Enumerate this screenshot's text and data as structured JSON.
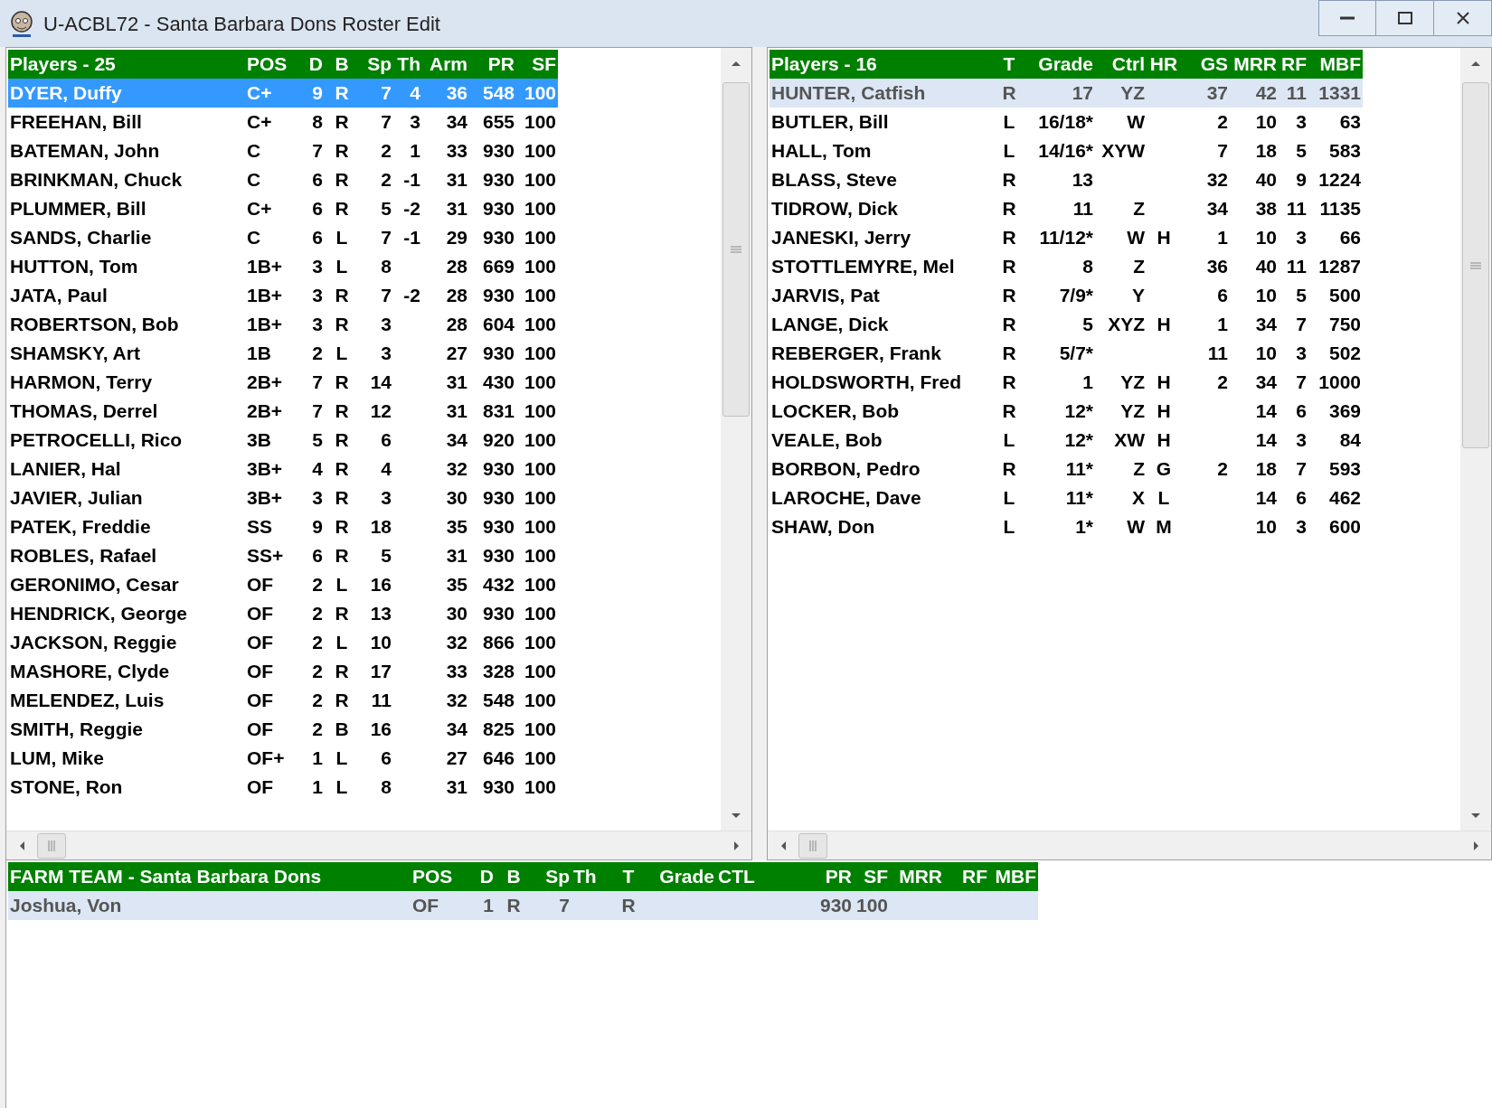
{
  "window": {
    "title": "U-ACBL72 - Santa Barbara Dons Roster Edit"
  },
  "hitters": {
    "columns": [
      "Players - 25",
      "POS",
      "D",
      "B",
      "Sp",
      "Th",
      "Arm",
      "PR",
      "SF"
    ],
    "rows": [
      {
        "selected": true,
        "cells": [
          "DYER, Duffy",
          "C+",
          "9",
          "R",
          "7",
          "4",
          "36",
          "548",
          "100"
        ]
      },
      {
        "selected": false,
        "cells": [
          "FREEHAN, Bill",
          "C+",
          "8",
          "R",
          "7",
          "3",
          "34",
          "655",
          "100"
        ]
      },
      {
        "selected": false,
        "cells": [
          "BATEMAN, John",
          "C",
          "7",
          "R",
          "2",
          "1",
          "33",
          "930",
          "100"
        ]
      },
      {
        "selected": false,
        "cells": [
          "BRINKMAN, Chuck",
          "C",
          "6",
          "R",
          "2",
          "-1",
          "31",
          "930",
          "100"
        ]
      },
      {
        "selected": false,
        "cells": [
          "PLUMMER, Bill",
          "C+",
          "6",
          "R",
          "5",
          "-2",
          "31",
          "930",
          "100"
        ]
      },
      {
        "selected": false,
        "cells": [
          "SANDS, Charlie",
          "C",
          "6",
          "L",
          "7",
          "-1",
          "29",
          "930",
          "100"
        ]
      },
      {
        "selected": false,
        "cells": [
          "HUTTON, Tom",
          "1B+",
          "3",
          "L",
          "8",
          "",
          "28",
          "669",
          "100"
        ]
      },
      {
        "selected": false,
        "cells": [
          "JATA, Paul",
          "1B+",
          "3",
          "R",
          "7",
          "-2",
          "28",
          "930",
          "100"
        ]
      },
      {
        "selected": false,
        "cells": [
          "ROBERTSON, Bob",
          "1B+",
          "3",
          "R",
          "3",
          "",
          "28",
          "604",
          "100"
        ]
      },
      {
        "selected": false,
        "cells": [
          "SHAMSKY, Art",
          "1B",
          "2",
          "L",
          "3",
          "",
          "27",
          "930",
          "100"
        ]
      },
      {
        "selected": false,
        "cells": [
          "HARMON, Terry",
          "2B+",
          "7",
          "R",
          "14",
          "",
          "31",
          "430",
          "100"
        ]
      },
      {
        "selected": false,
        "cells": [
          "THOMAS, Derrel",
          "2B+",
          "7",
          "R",
          "12",
          "",
          "31",
          "831",
          "100"
        ]
      },
      {
        "selected": false,
        "cells": [
          "PETROCELLI, Rico",
          "3B",
          "5",
          "R",
          "6",
          "",
          "34",
          "920",
          "100"
        ]
      },
      {
        "selected": false,
        "cells": [
          "LANIER, Hal",
          "3B+",
          "4",
          "R",
          "4",
          "",
          "32",
          "930",
          "100"
        ]
      },
      {
        "selected": false,
        "cells": [
          "JAVIER, Julian",
          "3B+",
          "3",
          "R",
          "3",
          "",
          "30",
          "930",
          "100"
        ]
      },
      {
        "selected": false,
        "cells": [
          "PATEK, Freddie",
          "SS",
          "9",
          "R",
          "18",
          "",
          "35",
          "930",
          "100"
        ]
      },
      {
        "selected": false,
        "cells": [
          "ROBLES, Rafael",
          "SS+",
          "6",
          "R",
          "5",
          "",
          "31",
          "930",
          "100"
        ]
      },
      {
        "selected": false,
        "cells": [
          "GERONIMO, Cesar",
          "OF",
          "2",
          "L",
          "16",
          "",
          "35",
          "432",
          "100"
        ]
      },
      {
        "selected": false,
        "cells": [
          "HENDRICK, George",
          "OF",
          "2",
          "R",
          "13",
          "",
          "30",
          "930",
          "100"
        ]
      },
      {
        "selected": false,
        "cells": [
          "JACKSON, Reggie",
          "OF",
          "2",
          "L",
          "10",
          "",
          "32",
          "866",
          "100"
        ]
      },
      {
        "selected": false,
        "cells": [
          "MASHORE, Clyde",
          "OF",
          "2",
          "R",
          "17",
          "",
          "33",
          "328",
          "100"
        ]
      },
      {
        "selected": false,
        "cells": [
          "MELENDEZ, Luis",
          "OF",
          "2",
          "R",
          "11",
          "",
          "32",
          "548",
          "100"
        ]
      },
      {
        "selected": false,
        "cells": [
          "SMITH, Reggie",
          "OF",
          "2",
          "B",
          "16",
          "",
          "34",
          "825",
          "100"
        ]
      },
      {
        "selected": false,
        "cells": [
          "LUM, Mike",
          "OF+",
          "1",
          "L",
          "6",
          "",
          "27",
          "646",
          "100"
        ]
      },
      {
        "selected": false,
        "cells": [
          "STONE, Ron",
          "OF",
          "1",
          "L",
          "8",
          "",
          "31",
          "930",
          "100"
        ]
      }
    ]
  },
  "pitchers": {
    "columns": [
      "Players - 16",
      "T",
      "Grade",
      "Ctrl",
      "HR",
      "GS",
      "MRR",
      "RF",
      "MBF"
    ],
    "rows": [
      {
        "selected": true,
        "cells": [
          "HUNTER, Catfish",
          "R",
          "17",
          "YZ",
          "",
          "37",
          "42",
          "11",
          "1331"
        ]
      },
      {
        "selected": false,
        "cells": [
          "BUTLER, Bill",
          "L",
          "16/18*",
          "W",
          "",
          "2",
          "10",
          "3",
          "63"
        ]
      },
      {
        "selected": false,
        "cells": [
          "HALL, Tom",
          "L",
          "14/16*",
          "XYW",
          "",
          "7",
          "18",
          "5",
          "583"
        ]
      },
      {
        "selected": false,
        "cells": [
          "BLASS, Steve",
          "R",
          "13",
          "",
          "",
          "32",
          "40",
          "9",
          "1224"
        ]
      },
      {
        "selected": false,
        "cells": [
          "TIDROW, Dick",
          "R",
          "11",
          "Z",
          "",
          "34",
          "38",
          "11",
          "1135"
        ]
      },
      {
        "selected": false,
        "cells": [
          "JANESKI, Jerry",
          "R",
          "11/12*",
          "W",
          "H",
          "1",
          "10",
          "3",
          "66"
        ]
      },
      {
        "selected": false,
        "cells": [
          "STOTTLEMYRE, Mel",
          "R",
          "8",
          "Z",
          "",
          "36",
          "40",
          "11",
          "1287"
        ]
      },
      {
        "selected": false,
        "cells": [
          "JARVIS, Pat",
          "R",
          "7/9*",
          "Y",
          "",
          "6",
          "10",
          "5",
          "500"
        ]
      },
      {
        "selected": false,
        "cells": [
          "LANGE, Dick",
          "R",
          "5",
          "XYZ",
          "H",
          "1",
          "34",
          "7",
          "750"
        ]
      },
      {
        "selected": false,
        "cells": [
          "REBERGER, Frank",
          "R",
          "5/7*",
          "",
          "",
          "11",
          "10",
          "3",
          "502"
        ]
      },
      {
        "selected": false,
        "cells": [
          "HOLDSWORTH, Fred",
          "R",
          "1",
          "YZ",
          "H",
          "2",
          "34",
          "7",
          "1000"
        ]
      },
      {
        "selected": false,
        "cells": [
          "LOCKER, Bob",
          "R",
          "12*",
          "YZ",
          "H",
          "",
          "14",
          "6",
          "369"
        ]
      },
      {
        "selected": false,
        "cells": [
          "VEALE, Bob",
          "L",
          "12*",
          "XW",
          "H",
          "",
          "14",
          "3",
          "84"
        ]
      },
      {
        "selected": false,
        "cells": [
          "BORBON, Pedro",
          "R",
          "11*",
          "Z",
          "G",
          "2",
          "18",
          "7",
          "593"
        ]
      },
      {
        "selected": false,
        "cells": [
          "LAROCHE, Dave",
          "L",
          "11*",
          "X",
          "L",
          "",
          "14",
          "6",
          "462"
        ]
      },
      {
        "selected": false,
        "cells": [
          "SHAW, Don",
          "L",
          "1*",
          "W",
          "M",
          "",
          "10",
          "3",
          "600"
        ]
      }
    ]
  },
  "farm": {
    "columns": [
      "FARM TEAM - Santa Barbara Dons",
      "POS",
      "D",
      "B",
      "Sp",
      "Th",
      "T",
      "Grade",
      "CTL",
      "PR",
      "SF",
      "MRR",
      "RF",
      "MBF"
    ],
    "rows": [
      {
        "selected": true,
        "cells": [
          "Joshua, Von",
          "OF",
          "1",
          "R",
          "7",
          "",
          "R",
          "",
          "",
          "930",
          "100",
          "",
          "",
          ""
        ]
      }
    ]
  }
}
